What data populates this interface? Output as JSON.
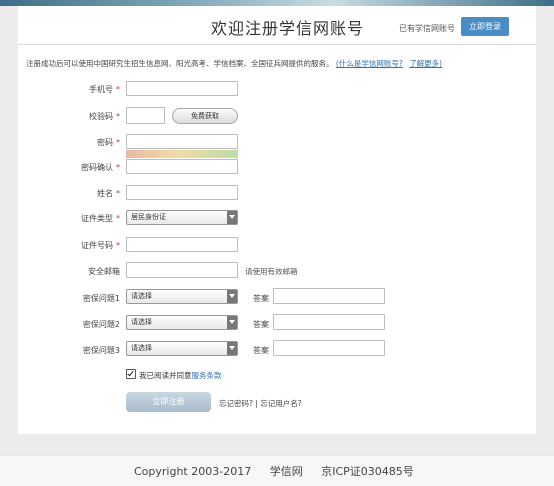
{
  "header": {
    "title": "欢迎注册学信网账号",
    "have_account": "已有学信网账号",
    "login_button": "立即登录"
  },
  "notice": {
    "text": "注册成功后可以使用中国研究生招生信息网、阳光高考、学信档案、全国征兵网提供的服务。",
    "link1": "(什么是学信网账号?",
    "link2": "了解更多)"
  },
  "form": {
    "phone_label": "手机号",
    "code_label": "校验码",
    "code_button": "免费获取",
    "password_label": "密码",
    "confirm_label": "密码确认",
    "name_label": "姓名",
    "id_type_label": "证件类型",
    "id_type_value": "居民身份证",
    "id_number_label": "证件号码",
    "email_label": "安全邮箱",
    "email_hint": "请使用有效邮箱",
    "q1_label": "密保问题1",
    "q2_label": "密保问题2",
    "q3_label": "密保问题3",
    "select_placeholder": "请选择",
    "answer_label": "答案",
    "required_mark": "*",
    "agree_text": "我已阅读并同意",
    "agree_link": "服务条款",
    "register_button": "立即注册",
    "forgot_password": "忘记密码?",
    "forgot_separator": "|",
    "forgot_username": "忘记用户名?"
  },
  "footer": {
    "copyright": "Copyright 2003-2017",
    "site": "学信网",
    "icp": "京ICP证030485号"
  },
  "colors": {
    "accent": "#4a8cc6",
    "link": "#2f6fb5",
    "register_button": "#b7c9d6"
  }
}
